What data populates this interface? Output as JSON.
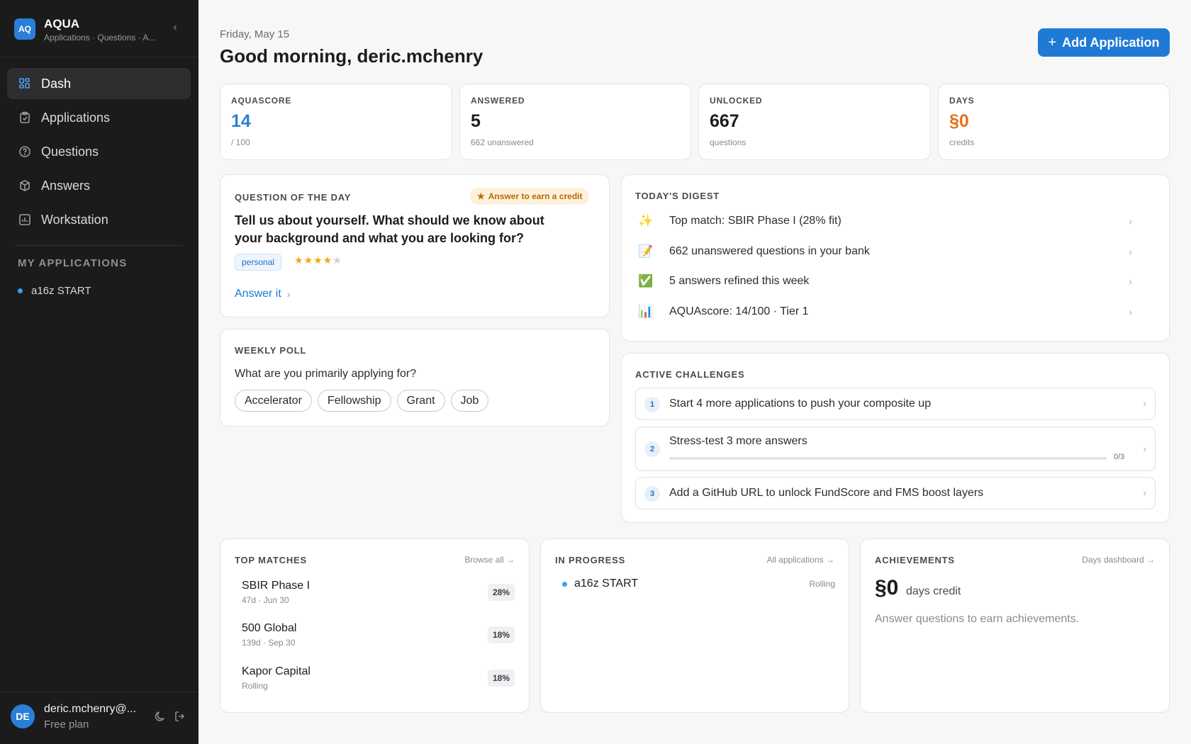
{
  "brand": {
    "logo": "AQ",
    "title": "AQUA",
    "subtitle": "Applications · Questions · A..."
  },
  "nav": [
    {
      "label": "Dash",
      "icon": "grid-icon",
      "active": true
    },
    {
      "label": "Applications",
      "icon": "clipboard-icon"
    },
    {
      "label": "Questions",
      "icon": "question-circle-icon"
    },
    {
      "label": "Answers",
      "icon": "box-icon"
    },
    {
      "label": "Workstation",
      "icon": "chart-icon"
    }
  ],
  "my_applications": {
    "title": "MY APPLICATIONS",
    "items": [
      "a16z START"
    ]
  },
  "user": {
    "initials": "DE",
    "email": "deric.mchenry@...",
    "plan": "Free plan"
  },
  "header": {
    "date": "Friday, May 15",
    "greeting": "Good morning, deric.mchenry",
    "add_button": "Add Application"
  },
  "stats": [
    {
      "label": "AQUASCORE",
      "value": "14",
      "sub": "/ 100",
      "color": "#2b7fd8"
    },
    {
      "label": "ANSWERED",
      "value": "5",
      "sub": "662 unanswered",
      "color": "#1c1c1e"
    },
    {
      "label": "UNLOCKED",
      "value": "667",
      "sub": "questions",
      "color": "#1c1c1e"
    },
    {
      "label": "DAYS",
      "value": "§0",
      "sub": "credits",
      "color": "#e8701a"
    }
  ],
  "question_of_day": {
    "title": "QUESTION OF THE DAY",
    "badge": "Answer to earn a credit",
    "question": "Tell us about yourself. What should we know about your background and what you are looking for?",
    "tag": "personal",
    "rating": 4,
    "rating_max": 5,
    "action": "Answer it"
  },
  "weekly_poll": {
    "title": "WEEKLY POLL",
    "question": "What are you primarily applying for?",
    "options": [
      "Accelerator",
      "Fellowship",
      "Grant",
      "Job"
    ]
  },
  "digest": {
    "title": "TODAY'S DIGEST",
    "items": [
      {
        "emoji": "✨",
        "text": "Top match: SBIR Phase I (28% fit)"
      },
      {
        "emoji": "📝",
        "text": "662 unanswered questions in your bank"
      },
      {
        "emoji": "✅",
        "text": "5 answers refined this week"
      },
      {
        "emoji": "📊",
        "text": "AQUAscore: 14/100 · Tier 1"
      }
    ]
  },
  "challenges": {
    "title": "ACTIVE CHALLENGES",
    "items": [
      {
        "num": "1",
        "text": "Start 4 more applications to push your composite up"
      },
      {
        "num": "2",
        "text": "Stress-test 3 more answers",
        "progress": 0,
        "progress_label": "0/3"
      },
      {
        "num": "3",
        "text": "Add a GitHub URL to unlock FundScore and FMS boost layers"
      }
    ]
  },
  "top_matches": {
    "title": "TOP MATCHES",
    "link": "Browse all →",
    "items": [
      {
        "name": "SBIR Phase I",
        "meta": "47d · Jun 30",
        "pct": "28%"
      },
      {
        "name": "500 Global",
        "meta": "139d · Sep 30",
        "pct": "18%"
      },
      {
        "name": "Kapor Capital",
        "meta": "Rolling",
        "pct": "18%"
      }
    ]
  },
  "in_progress": {
    "title": "IN PROGRESS",
    "link": "All applications →",
    "items": [
      {
        "name": "a16z START",
        "status": "Rolling"
      }
    ]
  },
  "achievements": {
    "title": "ACHIEVEMENTS",
    "link": "Days dashboard →",
    "value": "§0",
    "unit": "days credit",
    "empty": "Answer questions to earn achievements."
  }
}
